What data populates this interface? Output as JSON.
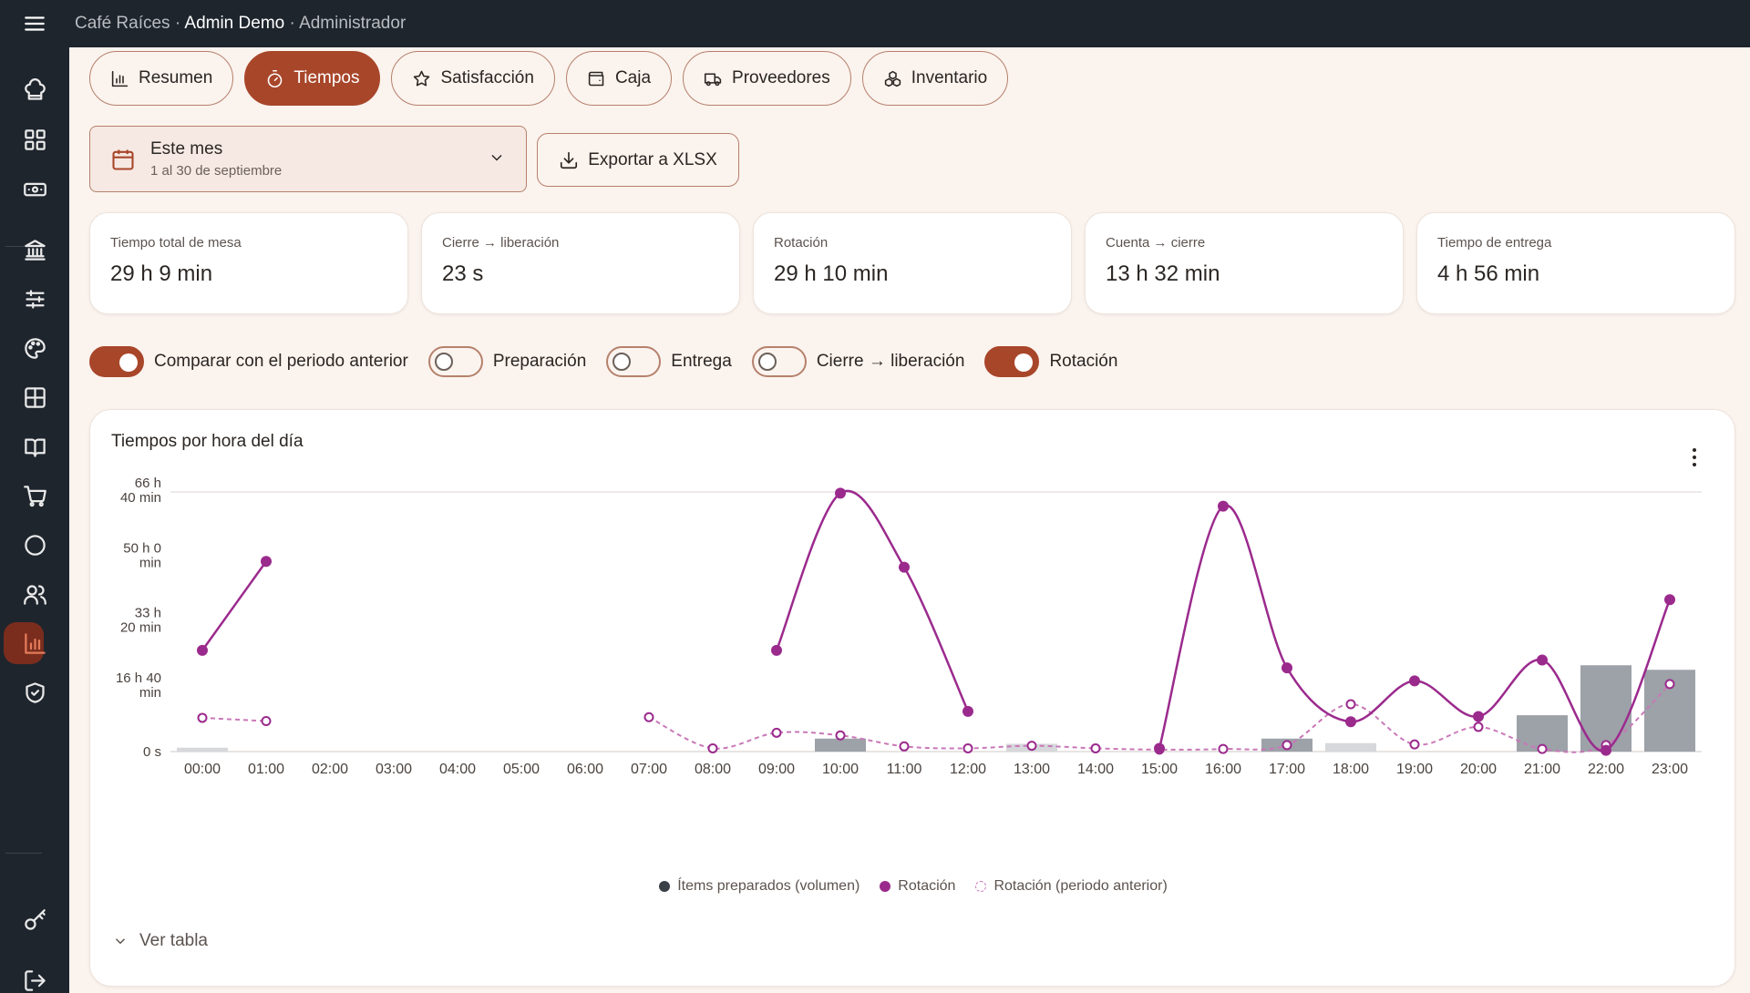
{
  "header": {
    "app_name": "Café Raíces",
    "sep": "·",
    "user": "Admin Demo",
    "role": "Administrador"
  },
  "sidebar": {
    "icons": [
      "chef-hat-icon",
      "grid-icon",
      "cash-icon",
      "bank-icon",
      "sliders-icon",
      "palette-icon",
      "table-icon",
      "book-icon",
      "cart-icon",
      "circle-icon",
      "users-icon",
      "bar-chart-icon",
      "shield-icon",
      "key-icon",
      "logout-icon"
    ],
    "active": "bar-chart-icon"
  },
  "tabs": [
    {
      "label": "Resumen",
      "icon": "bar-chart-icon",
      "active": false
    },
    {
      "label": "Tiempos",
      "icon": "timer-icon",
      "active": true
    },
    {
      "label": "Satisfacción",
      "icon": "star-icon",
      "active": false
    },
    {
      "label": "Caja",
      "icon": "wallet-icon",
      "active": false
    },
    {
      "label": "Proveedores",
      "icon": "truck-icon",
      "active": false
    },
    {
      "label": "Inventario",
      "icon": "boxes-icon",
      "active": false
    }
  ],
  "period": {
    "label": "Este mes",
    "range": "1 al 30 de septiembre"
  },
  "export": {
    "label": "Exportar a XLSX"
  },
  "kpis": [
    {
      "label": "Tiempo total de mesa",
      "value": "29 h 9 min"
    },
    {
      "label": "Cierre → liberación",
      "value": "23 s"
    },
    {
      "label": "Rotación",
      "value": "29 h 10 min"
    },
    {
      "label": "Cuenta → cierre",
      "value": "13 h 32 min"
    },
    {
      "label": "Tiempo de entrega",
      "value": "4 h 56 min"
    }
  ],
  "toggles": [
    {
      "label": "Comparar con el periodo anterior",
      "on": true
    },
    {
      "label": "Preparación",
      "on": false
    },
    {
      "label": "Entrega",
      "on": false
    },
    {
      "label": "Cierre → liberación",
      "on": false
    },
    {
      "label": "Rotación",
      "on": true
    }
  ],
  "chart": {
    "title": "Tiempos por hora del día",
    "toggle_table": "Ver tabla"
  },
  "chart_data": {
    "type": "line",
    "title": "Tiempos por hora del día",
    "categories": [
      "00:00",
      "01:00",
      "02:00",
      "03:00",
      "04:00",
      "05:00",
      "06:00",
      "07:00",
      "08:00",
      "09:00",
      "10:00",
      "11:00",
      "12:00",
      "13:00",
      "14:00",
      "15:00",
      "16:00",
      "17:00",
      "18:00",
      "19:00",
      "20:00",
      "21:00",
      "22:00",
      "23:00"
    ],
    "y_unit": "minutes",
    "ylim": [
      0,
      4000
    ],
    "y_tick_values": [
      0,
      1000,
      2000,
      3000,
      4000
    ],
    "y_tick_labels": [
      [
        "0 s"
      ],
      [
        "16 h 40",
        "min"
      ],
      [
        "33 h",
        "20 min"
      ],
      [
        "50 h 0",
        "min"
      ],
      [
        "66 h",
        "40 min"
      ]
    ],
    "grid": "top line only",
    "series": [
      {
        "name": "Ítems preparados (volumen)",
        "kind": "bar",
        "color": "#9da1a8",
        "prev_color": "#d6d8db",
        "values": [
          0,
          0,
          0,
          0,
          0,
          0,
          0,
          0,
          0,
          0,
          200,
          0,
          0,
          0,
          0,
          0,
          0,
          200,
          0,
          0,
          0,
          560,
          1330,
          1260
        ],
        "prev_values": [
          60,
          0,
          0,
          0,
          0,
          0,
          0,
          0,
          0,
          0,
          0,
          0,
          0,
          120,
          0,
          0,
          0,
          0,
          130,
          0,
          0,
          0,
          0,
          0
        ]
      },
      {
        "name": "Rotación",
        "kind": "line",
        "color": "#9b2a8d",
        "values": [
          1560,
          2930,
          null,
          null,
          null,
          null,
          null,
          null,
          null,
          1560,
          3980,
          2840,
          620,
          null,
          null,
          50,
          3780,
          1290,
          460,
          1090,
          540,
          1410,
          20,
          2340
        ]
      },
      {
        "name": "Rotación (periodo anterior)",
        "kind": "line-dashed",
        "color": "#c978b8",
        "values": [
          520,
          470,
          null,
          null,
          null,
          null,
          null,
          530,
          50,
          290,
          250,
          80,
          50,
          90,
          50,
          30,
          40,
          100,
          730,
          110,
          380,
          40,
          100,
          1040
        ]
      }
    ],
    "legend_position": "bottom"
  }
}
